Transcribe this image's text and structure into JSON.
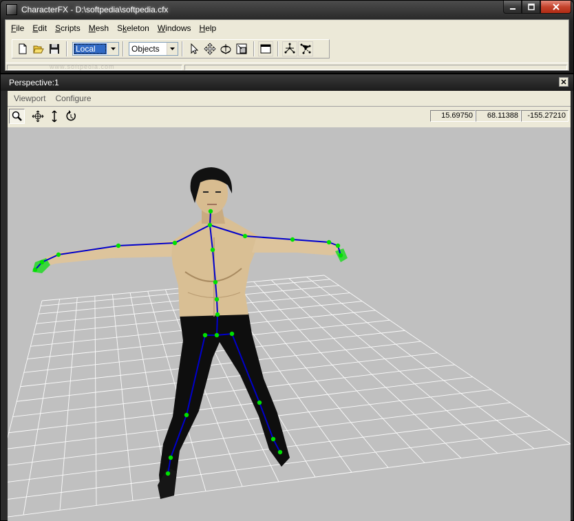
{
  "window": {
    "title": "CharacterFX - D:\\softpedia\\softpedia.cfx"
  },
  "menu": [
    {
      "label": "File",
      "key": "F"
    },
    {
      "label": "Edit",
      "key": "E"
    },
    {
      "label": "Scripts",
      "key": "S"
    },
    {
      "label": "Mesh",
      "key": "M"
    },
    {
      "label": "Skeleton",
      "key": "k"
    },
    {
      "label": "Windows",
      "key": "W"
    },
    {
      "label": "Help",
      "key": "H"
    }
  ],
  "toolbar": {
    "coord_space": "Local",
    "selection_mode": "Objects"
  },
  "watermark": "www.softpedia.com",
  "viewport": {
    "title": "Perspective:1",
    "menu": [
      "Viewport",
      "Configure"
    ],
    "coords": {
      "x": "15.69750",
      "y": "68.11388",
      "z": "-155.27210"
    }
  },
  "colors": {
    "bone": "#0000cc",
    "joint": "#00e000",
    "grid": "#ffffff",
    "background": "#c0c0c0"
  },
  "icons": {
    "tools": [
      "new-file-icon",
      "open-folder-icon",
      "save-disk-icon",
      "pointer-icon",
      "move-icon",
      "rotate-icon",
      "scale-icon",
      "window-icon",
      "bone-create-icon",
      "bone-link-icon"
    ],
    "viewport_tools": [
      "zoom-icon",
      "pan-icon",
      "dolly-icon",
      "orbit-icon"
    ]
  }
}
